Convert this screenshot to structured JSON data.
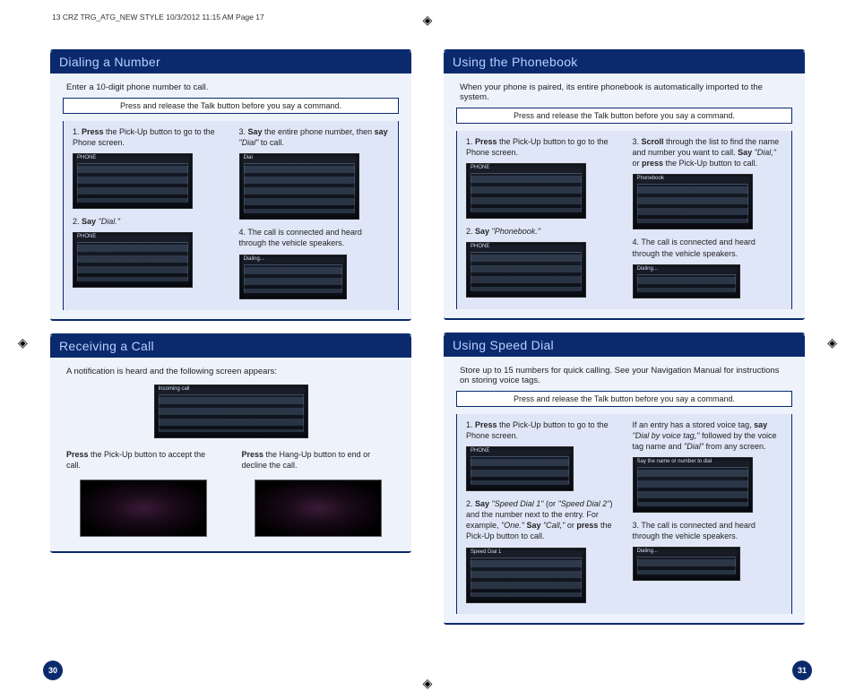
{
  "header": "13 CRZ TRG_ATG_NEW STYLE  10/3/2012  11:15 AM  Page 17",
  "page_left_num": "30",
  "page_right_num": "31",
  "talk_note": "Press and release the Talk button before you say a command.",
  "dialing": {
    "title": "Dialing a Number",
    "intro": "Enter a 10-digit phone number to call.",
    "step1_a": "Press",
    "step1_b": " the Pick-Up button to go to the Phone screen.",
    "step3_a": "Say",
    "step3_b": " the entire phone number, then ",
    "step3_c": "say",
    "step3_d": " \"Dial\"",
    "step3_e": " to call.",
    "step2_a": "Say",
    "step2_b": " \"Dial.\"",
    "step4": "The call is connected and heard through the vehicle speakers.",
    "sc1": "PHONE",
    "sc2": "PHONE",
    "sc3": "Dial",
    "sc4": "Dialing..."
  },
  "receiving": {
    "title": "Receiving a Call",
    "intro": "A notification is heard and the following screen appears:",
    "sc": "Incoming call",
    "left_a": "Press",
    "left_b": " the Pick-Up button to accept the call.",
    "right_a": "Press",
    "right_b": " the Hang-Up button to end or decline the call."
  },
  "phonebook": {
    "title": "Using the Phonebook",
    "intro": "When your phone is paired, its entire phonebook is automatically imported to the system.",
    "step1_a": "Press",
    "step1_b": " the Pick-Up button to go to the Phone screen.",
    "step3_a": "Scroll",
    "step3_b": " through the list to find the name and number you want to call. ",
    "step3_c": "Say",
    "step3_d": " \"Dial,\"",
    "step3_e": " or ",
    "step3_f": "press",
    "step3_g": " the Pick-Up button to call.",
    "step2_a": "Say",
    "step2_b": " \"Phonebook.\"",
    "step4": "The call is connected and heard through the vehicle speakers.",
    "sc1": "PHONE",
    "sc2": "PHONE",
    "sc3": "Phonebook",
    "sc4": "Dialing..."
  },
  "speed": {
    "title": "Using Speed Dial",
    "intro": "Store up to 15 numbers for quick calling. See your Navigation Manual for instructions on storing voice tags.",
    "step1_a": "Press",
    "step1_b": " the Pick-Up button to go to the Phone screen.",
    "right1_a": "If an entry has a stored voice tag, ",
    "right1_b": "say",
    "right1_c": " \"Dial by voice tag,\"",
    "right1_d": " followed by the voice tag name and ",
    "right1_e": "\"Dial\"",
    "right1_f": " from any screen.",
    "step2_a": "Say",
    "step2_b": " \"Speed Dial 1\"",
    "step2_c": " (or ",
    "step2_d": "\"Speed Dial 2\"",
    "step2_e": ") and the number next to the entry. For example, ",
    "step2_f": "\"One.\"",
    "step2_g": " Say",
    "step2_h": " \"Call,\"",
    "step2_i": " or ",
    "step2_j": "press",
    "step2_k": " the Pick-Up button to call.",
    "step3": "The call is connected and heard through the vehicle speakers.",
    "sc1": "PHONE",
    "sc2": "Speed Dial 1",
    "sc3": "Say the name or number to dial",
    "sc4": "Dialing..."
  }
}
